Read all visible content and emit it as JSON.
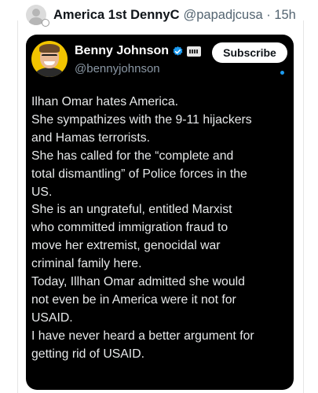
{
  "post": {
    "author_name": "America 1st DennyC",
    "author_handle": "@papadjcusa",
    "separator": "·",
    "time": "15h"
  },
  "card": {
    "name": "Benny Johnson",
    "handle": "@bennyjohnson",
    "subscribe_label": "Subscribe",
    "lines": [
      "Ilhan Omar hates America.",
      "She sympathizes with the 9-11 hijackers",
      "and Hamas terrorists.",
      "She has called for the “complete and",
      "total dismantling” of Police forces in the",
      "US.",
      "She is an ungrateful, entitled Marxist",
      "who committed immigration fraud to",
      "move her extremist, genocidal war",
      "criminal family here.",
      "Today, Illhan Omar admitted she would",
      "not even be in America were it not for",
      "USAID.",
      "I have never heard a better argument for",
      "getting rid of USAID."
    ]
  },
  "colors": {
    "card_background": "#000000",
    "verified_blue": "#1d9bf0",
    "avatar_yellow": "#f2c400",
    "handle_gray": "#536471"
  },
  "icons": {
    "verified": "verified-badge-icon",
    "affiliate": "affiliate-badge-icon"
  }
}
